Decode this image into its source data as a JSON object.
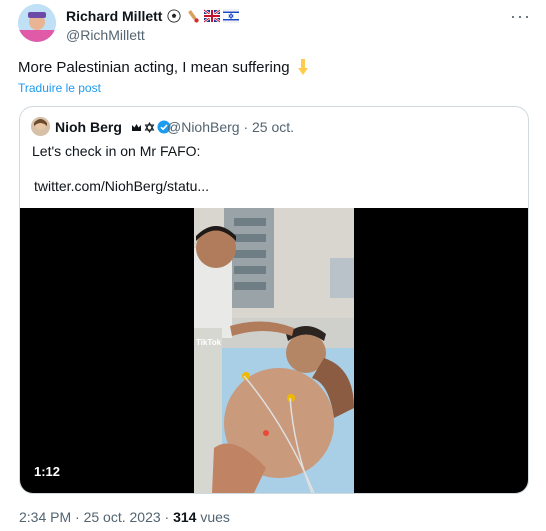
{
  "tweet": {
    "author_name": "Richard Millett",
    "author_handle": "@RichMillett",
    "author_badges": [
      "soccer-ball-emoji",
      "cricket-bat-emoji",
      "uk-flag-emoji",
      "israel-flag-emoji"
    ],
    "text": "More Palestinian acting, I mean suffering",
    "text_emoji": "pointing-down-emoji",
    "translate_label": "Traduire le post",
    "more_label": "···",
    "time": "2:34 PM",
    "date": "25 oct. 2023",
    "views_count": "314",
    "views_label": "vues",
    "separator": "·"
  },
  "quoted": {
    "author_name": "Nioh Berg",
    "author_badges": [
      "crown-emoji",
      "star-of-david-emoji",
      "verified-badge-icon"
    ],
    "author_handle": "@NiohBerg",
    "date": "· 25 oct.",
    "text": "Let's check in on Mr FAFO:",
    "link": "twitter.com/NiohBerg/statu...",
    "video_duration": "1:12",
    "watermark": "TikTok"
  },
  "colors": {
    "accent": "#1d9bf0",
    "secondary_text": "#536471",
    "border": "#cfd9de"
  }
}
